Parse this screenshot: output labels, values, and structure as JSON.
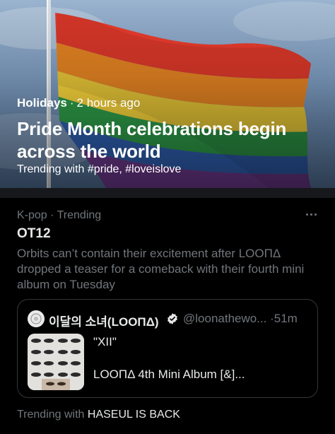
{
  "hero": {
    "category": "Holidays",
    "separator": "·",
    "time": "2 hours ago",
    "title": "Pride Month celebrations begin across the world",
    "subtitle": "Trending with #pride, #loveislove"
  },
  "trend": {
    "meta": "K-pop · Trending",
    "name": "OT12",
    "description": "Orbits can’t contain their excitement after LOOΠΔ dropped a teaser for a comeback with their fourth mini album on Tuesday",
    "more_icon": "ellipsis-icon"
  },
  "quote": {
    "author": "이달의 소녀(LOOΠΔ)",
    "handle_time": "@loonathewo... ·51m",
    "line1": "\"XII\"",
    "line2": "LOOΠΔ 4th Mini Album [&]...",
    "verified_color": "#e7e9ea"
  },
  "footer": {
    "prefix": "Trending with",
    "tag": "HASEUL IS BACK"
  },
  "colors": {
    "background": "#000000",
    "primary_text": "#e7e9ea",
    "secondary_text": "#71767b",
    "border": "#333639"
  }
}
